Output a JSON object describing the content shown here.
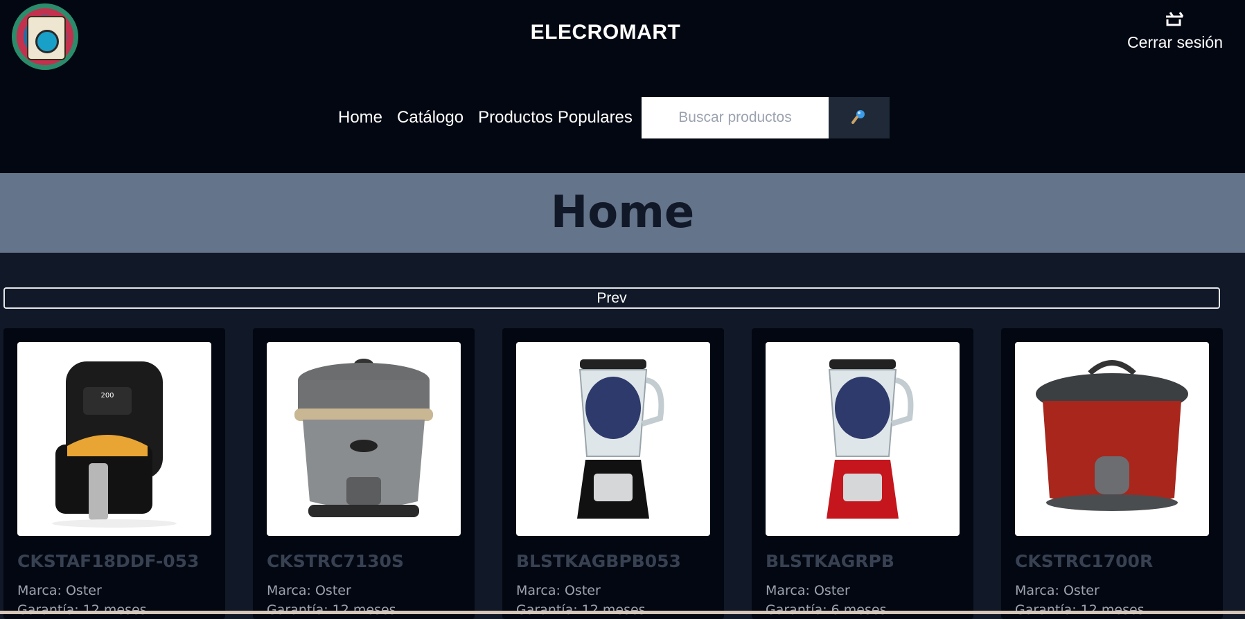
{
  "header": {
    "brand": "ELECROMART",
    "logout_label": "Cerrar sesión",
    "logout_icon": "logout-icon"
  },
  "nav": {
    "items": [
      {
        "label": "Home"
      },
      {
        "label": "Catálogo"
      },
      {
        "label": "Productos Populares"
      }
    ]
  },
  "search": {
    "placeholder": "Buscar productos",
    "button_icon": "search-icon"
  },
  "page": {
    "title": "Home",
    "prev_label": "Prev"
  },
  "products": [
    {
      "code": "CKSTAF18DDF-053",
      "brand": "Marca: Oster",
      "warranty": "Garantía: 12 meses",
      "kind": "air-fryer"
    },
    {
      "code": "CKSTRC7130S",
      "brand": "Marca: Oster",
      "warranty": "Garantía: 12 meses",
      "kind": "rice-cooker-gray"
    },
    {
      "code": "BLSTKAGBPB053",
      "brand": "Marca: Oster",
      "warranty": "Garantía: 12 meses",
      "kind": "blender-black"
    },
    {
      "code": "BLSTKAGRPB",
      "brand": "Marca: Oster",
      "warranty": "Garantía: 6 meses",
      "kind": "blender-red"
    },
    {
      "code": "CKSTRC1700R",
      "brand": "Marca: Oster",
      "warranty": "Garantía: 12 meses",
      "kind": "rice-cooker-red"
    }
  ],
  "colors": {
    "header_bg": "#030712",
    "page_bg": "#111827",
    "banner_bg": "#64748b",
    "card_bg": "#030712"
  }
}
